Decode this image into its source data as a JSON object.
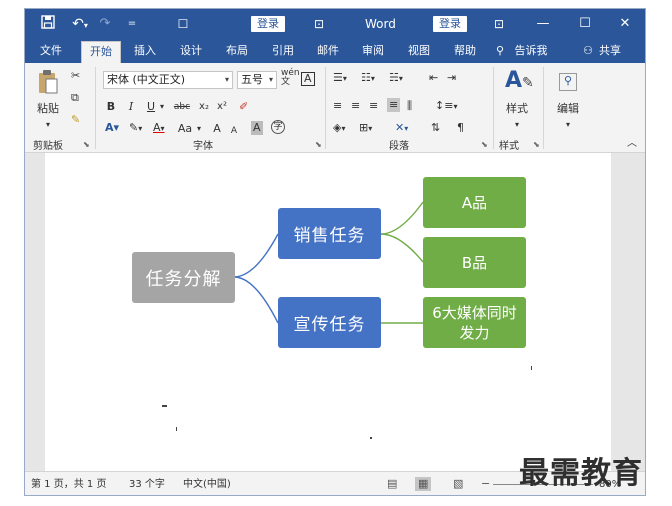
{
  "titlebar": {
    "save_icon": "save-icon",
    "undo_icon": "undo-icon",
    "redo_icon": "redo-icon",
    "customize_icon": "customize-qat-icon",
    "login_left": "登录",
    "title": "Word",
    "login_right": "登录",
    "minimize": "—",
    "maximize": "☐",
    "close": "✕"
  },
  "tabs": [
    {
      "label": "文件"
    },
    {
      "label": "开始"
    },
    {
      "label": "插入"
    },
    {
      "label": "设计"
    },
    {
      "label": "布局"
    },
    {
      "label": "引用"
    },
    {
      "label": "邮件"
    },
    {
      "label": "审阅"
    },
    {
      "label": "视图"
    },
    {
      "label": "帮助"
    },
    {
      "label": "告诉我"
    },
    {
      "label": "共享"
    }
  ],
  "ribbon": {
    "clipboard": {
      "label": "剪贴板",
      "paste": "粘贴"
    },
    "font": {
      "label": "字体",
      "font_name": "宋体 (中文正文)",
      "font_size": "五号",
      "bold": "B",
      "italic": "I",
      "underline": "U",
      "strike": "abc",
      "subscript": "x₂",
      "superscript": "x²",
      "change_case": "Aa",
      "grow": "A",
      "shrink": "A"
    },
    "paragraph": {
      "label": "段落"
    },
    "styles": {
      "label": "样式",
      "button": "样式"
    },
    "editing": {
      "button": "编辑"
    }
  },
  "document": {
    "root": "任务分解",
    "branches": [
      {
        "label": "销售任务",
        "children": [
          "A品",
          "B品"
        ]
      },
      {
        "label": "宣传任务",
        "children": [
          "6大媒体同时发力"
        ]
      }
    ],
    "colors": {
      "root": "#a5a5a5",
      "branch": "#4472c4",
      "leaf": "#70ad47",
      "connector": "#4472c4",
      "leaf_connector": "#70ad47"
    }
  },
  "statusbar": {
    "page": "第 1 页，共 1 页",
    "words": "33 个字",
    "language": "中文(中国)",
    "zoom": "80%"
  },
  "watermark": "最需教育"
}
